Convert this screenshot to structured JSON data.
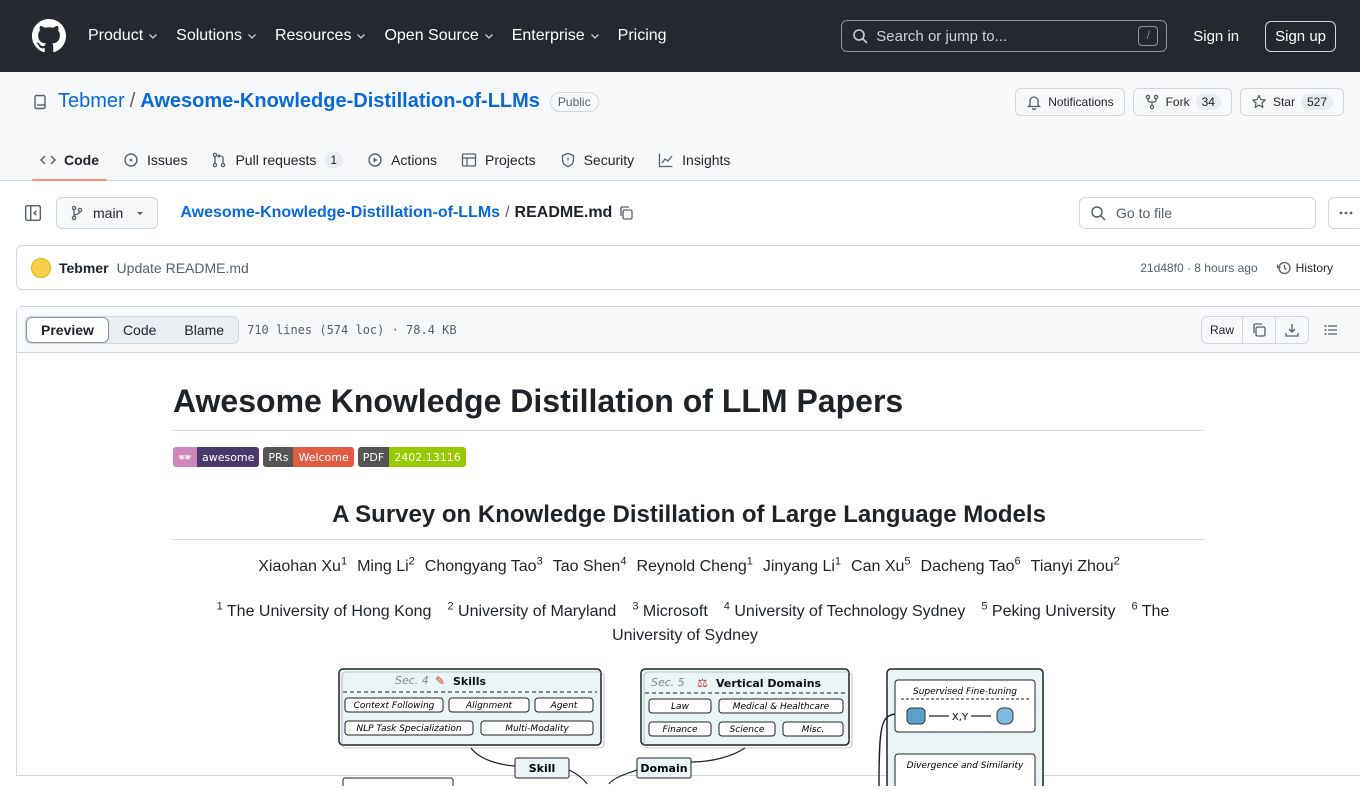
{
  "header": {
    "nav": [
      "Product",
      "Solutions",
      "Resources",
      "Open Source",
      "Enterprise",
      "Pricing"
    ],
    "nav_has_dropdown": [
      true,
      true,
      true,
      true,
      true,
      false
    ],
    "search_placeholder": "Search or jump to...",
    "search_shortcut": "/",
    "sign_in": "Sign in",
    "sign_up": "Sign up"
  },
  "repo": {
    "owner": "Tebmer",
    "separator": "/",
    "name": "Awesome-Knowledge-Distillation-of-LLMs",
    "visibility": "Public",
    "notifications_label": "Notifications",
    "fork_label": "Fork",
    "fork_count": "34",
    "star_label": "Star",
    "star_count": "527"
  },
  "tabs": [
    {
      "label": "Code",
      "icon": "code-icon",
      "active": true
    },
    {
      "label": "Issues",
      "icon": "issue-icon"
    },
    {
      "label": "Pull requests",
      "icon": "pull-request-icon",
      "count": "1"
    },
    {
      "label": "Actions",
      "icon": "play-icon"
    },
    {
      "label": "Projects",
      "icon": "table-icon"
    },
    {
      "label": "Security",
      "icon": "shield-icon"
    },
    {
      "label": "Insights",
      "icon": "graph-icon"
    }
  ],
  "file_bar": {
    "branch": "main",
    "repo_link": "Awesome-Knowledge-Distillation-of-LLMs",
    "separator": "/",
    "file": "README.md",
    "goto_placeholder": "Go to file"
  },
  "commit": {
    "author": "Tebmer",
    "message": "Update README.md",
    "meta": "21d48f0 · 8 hours ago",
    "history": "History"
  },
  "file_toolbar": {
    "views": [
      "Preview",
      "Code",
      "Blame"
    ],
    "info": "710 lines (574 loc) · 78.4 KB",
    "raw": "Raw"
  },
  "readme": {
    "title": "Awesome Knowledge Distillation of LLM Papers",
    "badges": [
      {
        "left": "🕶",
        "right": "awesome",
        "left_color": "#cc88bb",
        "right_color": "#4a3a6b"
      },
      {
        "left": "PRs",
        "right": "Welcome",
        "left_color": "#555555",
        "right_color": "#e05d44"
      },
      {
        "left": "PDF",
        "right": "2402.13116",
        "left_color": "#555555",
        "right_color": "#97ca00"
      }
    ],
    "subtitle": "A Survey on Knowledge Distillation of Large Language Models",
    "authors": [
      {
        "name": "Xiaohan Xu",
        "sup": "1"
      },
      {
        "name": "Ming Li",
        "sup": "2"
      },
      {
        "name": "Chongyang Tao",
        "sup": "3"
      },
      {
        "name": "Tao Shen",
        "sup": "4"
      },
      {
        "name": "Reynold Cheng",
        "sup": "1"
      },
      {
        "name": "Jinyang Li",
        "sup": "1"
      },
      {
        "name": "Can Xu",
        "sup": "5"
      },
      {
        "name": "Dacheng Tao",
        "sup": "6"
      },
      {
        "name": "Tianyi Zhou",
        "sup": "2"
      }
    ],
    "affiliations": [
      {
        "sup": "1",
        "name": "The University of Hong Kong"
      },
      {
        "sup": "2",
        "name": "University of Maryland"
      },
      {
        "sup": "3",
        "name": "Microsoft"
      },
      {
        "sup": "4",
        "name": "University of Technology Sydney"
      },
      {
        "sup": "5",
        "name": "Peking University"
      },
      {
        "sup": "6",
        "name": "The University of Sydney"
      }
    ],
    "figure": {
      "skills_sec": "Sec. 4",
      "skills_title": "Skills",
      "skills_items": [
        "Context Following",
        "Alignment",
        "Agent",
        "NLP Task Specialization",
        "Multi-Modality"
      ],
      "domains_sec": "Sec. 5",
      "domains_title": "Vertical Domains",
      "domains_items": [
        "Law",
        "Medical & Healthcare",
        "Finance",
        "Science",
        "Misc."
      ],
      "skill_tag": "Skill",
      "domain_tag": "Domain",
      "sft_title": "Supervised Fine-tuning",
      "sft_flow": "X,Y",
      "div_title": "Divergence and Similarity"
    }
  }
}
